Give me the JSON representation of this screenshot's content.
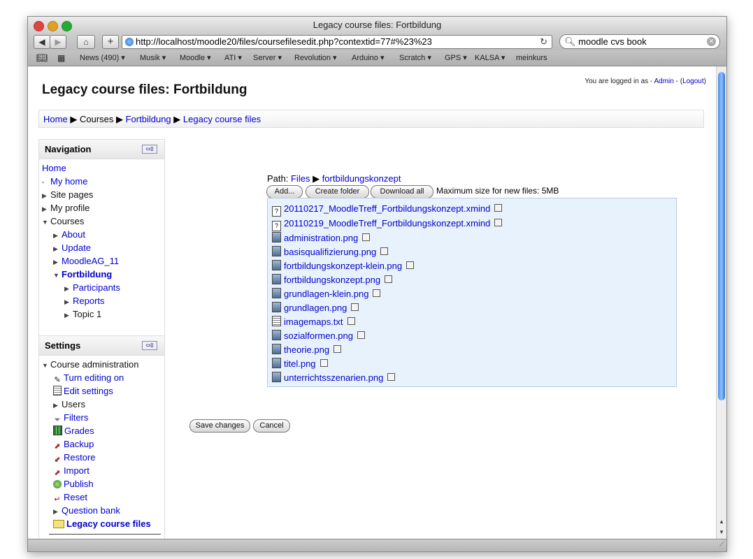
{
  "window": {
    "title": "Legacy course files: Fortbildung"
  },
  "browser": {
    "url": "http://localhost/moodle20/files/coursefilesedit.php?contextid=77#%23%23",
    "search": "moodle cvs book",
    "bookmarks": [
      "News (490)",
      "Musik",
      "Moodle",
      "ATI",
      "Server",
      "Revolution",
      "Arduino",
      "Scratch",
      "GPS",
      "KALSA",
      "meinkurs"
    ]
  },
  "page": {
    "title": "Legacy course files: Fortbildung",
    "login": {
      "prefix": "You are logged in as",
      "user": "Admin",
      "logout": "Logout"
    },
    "breadcrumb": [
      "Home",
      "Courses",
      "Fortbildung",
      "Legacy course files"
    ]
  },
  "navigation": {
    "title": "Navigation",
    "items": [
      "Home",
      "My home",
      "Site pages",
      "My profile",
      "Courses",
      "About",
      "Update",
      "MoodleAG_11",
      "Fortbildung",
      "Participants",
      "Reports",
      "Topic 1"
    ]
  },
  "settings": {
    "title": "Settings",
    "items": [
      "Course administration",
      "Turn editing on",
      "Edit settings",
      "Users",
      "Filters",
      "Grades",
      "Backup",
      "Restore",
      "Import",
      "Publish",
      "Reset",
      "Question bank",
      "Legacy course files"
    ]
  },
  "filemanager": {
    "path_label": "Path:",
    "path": [
      "Files",
      "fortbildungskonzept"
    ],
    "buttons": {
      "add": "Add...",
      "create_folder": "Create folder",
      "download_all": "Download all"
    },
    "max_size": "Maximum size for new files: 5MB",
    "files": [
      "20110217_MoodleTreff_Fortbildungskonzept.xmind",
      "20110219_MoodleTreff_Fortbildungskonzept.xmind",
      "administration.png",
      "basisqualifizierung.png",
      "fortbildungskonzept-klein.png",
      "fortbildungskonzept.png",
      "grundlagen-klein.png",
      "grundlagen.png",
      "imagemaps.txt",
      "sozialformen.png",
      "theorie.png",
      "titel.png",
      "unterrichtsszenarien.png"
    ]
  },
  "form": {
    "save": "Save changes",
    "cancel": "Cancel"
  }
}
